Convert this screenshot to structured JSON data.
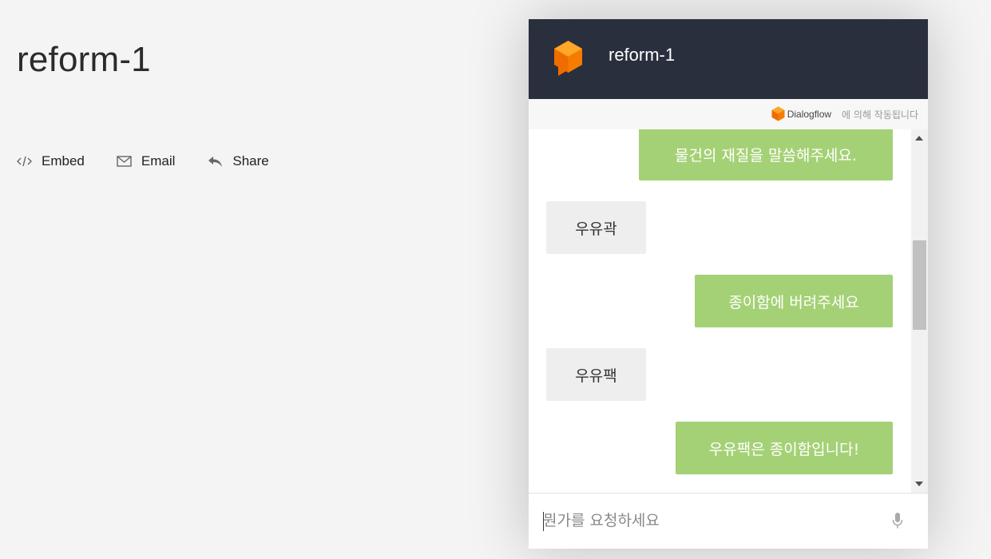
{
  "page": {
    "title": "reform-1",
    "actions": [
      {
        "label": "Embed",
        "icon": "code-icon"
      },
      {
        "label": "Email",
        "icon": "mail-icon"
      },
      {
        "label": "Share",
        "icon": "reply-icon"
      }
    ]
  },
  "widget": {
    "title": "reform-1",
    "powered_by": {
      "brand": "Dialogflow",
      "suffix": "에 의해 작동됩니다"
    },
    "messages": [
      {
        "from": "bot",
        "text": "물건의 재질을 말씀해주세요."
      },
      {
        "from": "user",
        "text": "우유곽"
      },
      {
        "from": "bot",
        "text": "종이함에 버려주세요"
      },
      {
        "from": "user",
        "text": "우유팩"
      },
      {
        "from": "bot",
        "text": "우유팩은 종이함입니다!"
      }
    ],
    "input": {
      "placeholder": "뭔가를 요청하세요",
      "value": ""
    },
    "colors": {
      "header": "#2a2f3d",
      "bot_bubble": "#a5d176",
      "user_bubble": "#eeeeee",
      "accent": "#f57c00"
    }
  }
}
